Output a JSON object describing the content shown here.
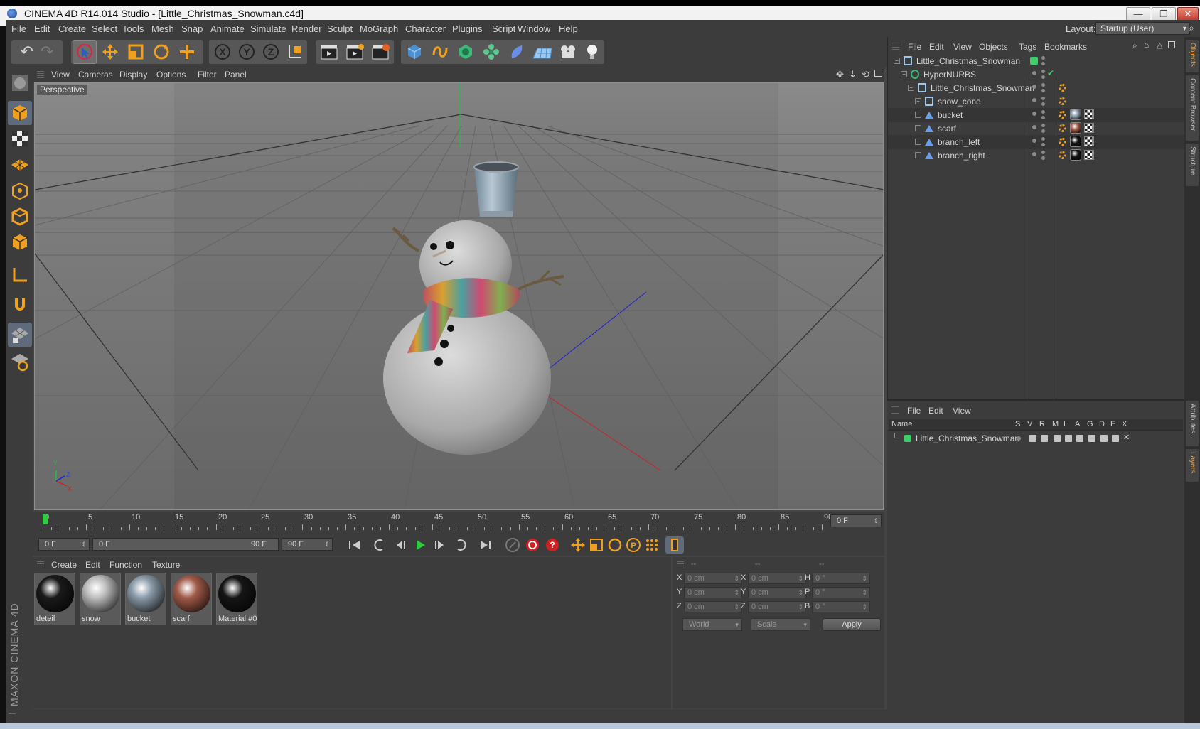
{
  "window": {
    "title": "CINEMA 4D R14.014 Studio - [Little_Christmas_Snowman.c4d]",
    "minimize": "—",
    "maximize": "❐",
    "close": "✕"
  },
  "menubar": {
    "items": [
      "File",
      "Edit",
      "Create",
      "Select",
      "Tools",
      "Mesh",
      "Snap",
      "Animate",
      "Simulate",
      "Render",
      "Sculpt",
      "MoGraph",
      "Character",
      "Plugins",
      "Script",
      "Window",
      "Help"
    ],
    "layout_label": "Layout:",
    "layout_value": "Startup (User)"
  },
  "viewport": {
    "menu": [
      "View",
      "Cameras",
      "Display",
      "Options",
      "Filter",
      "Panel"
    ],
    "label": "Perspective",
    "axis_labels": {
      "y": "Y",
      "x": "X",
      "z": "Z"
    }
  },
  "timeline": {
    "ticks": [
      "0",
      "5",
      "10",
      "15",
      "20",
      "25",
      "30",
      "35",
      "40",
      "45",
      "50",
      "55",
      "60",
      "65",
      "70",
      "75",
      "80",
      "85",
      "90"
    ],
    "current_frame": "0 F",
    "start_frame": "0 F",
    "range_start": "0 F",
    "range_end": "90 F",
    "end_frame": "90 F"
  },
  "materials": {
    "menu": [
      "Create",
      "Edit",
      "Function",
      "Texture"
    ],
    "items": [
      {
        "name": "deteil",
        "color": "#1a1a1a"
      },
      {
        "name": "snow",
        "color": "#bdbdbd"
      },
      {
        "name": "bucket",
        "color": "#8a9aa8"
      },
      {
        "name": "scarf",
        "color": "#a05a48"
      },
      {
        "name": "Material #0",
        "color": "#151515"
      }
    ]
  },
  "coordinates": {
    "header": [
      "--",
      "--",
      "--"
    ],
    "rows": [
      {
        "pos_label": "X",
        "pos": "0 cm",
        "size_label": "X",
        "size": "0 cm",
        "rot_label": "H",
        "rot": "0 °"
      },
      {
        "pos_label": "Y",
        "pos": "0 cm",
        "size_label": "Y",
        "size": "0 cm",
        "rot_label": "P",
        "rot": "0 °"
      },
      {
        "pos_label": "Z",
        "pos": "0 cm",
        "size_label": "Z",
        "size": "0 cm",
        "rot_label": "B",
        "rot": "0 °"
      }
    ],
    "space": "World",
    "mode": "Scale",
    "apply": "Apply"
  },
  "objects": {
    "menu": [
      "File",
      "Edit",
      "View",
      "Objects",
      "Tags",
      "Bookmarks"
    ],
    "tree": [
      {
        "name": "Little_Christmas_Snowman",
        "level": 0,
        "icon": "null-icon"
      },
      {
        "name": "HyperNURBS",
        "level": 1,
        "icon": "hypernurbs-icon"
      },
      {
        "name": "Little_Christmas_Snowman",
        "level": 2,
        "icon": "null-icon"
      },
      {
        "name": "snow_cone",
        "level": 3,
        "icon": "null-icon"
      },
      {
        "name": "bucket",
        "level": 3,
        "icon": "polygon-icon"
      },
      {
        "name": "scarf",
        "level": 3,
        "icon": "polygon-icon"
      },
      {
        "name": "branch_left",
        "level": 3,
        "icon": "polygon-icon"
      },
      {
        "name": "branch_right",
        "level": 3,
        "icon": "polygon-icon"
      }
    ]
  },
  "layers": {
    "menu": [
      "File",
      "Edit",
      "View"
    ],
    "columns": [
      "Name",
      "S",
      "V",
      "R",
      "M",
      "L",
      "A",
      "G",
      "D",
      "E",
      "X"
    ],
    "rows": [
      {
        "name": "Little_Christmas_Snowman"
      }
    ]
  },
  "side_tabs": {
    "top": [
      "Objects",
      "Content Browser",
      "Structure"
    ],
    "bottom": [
      "Attributes",
      "Layers"
    ]
  },
  "brand": {
    "text": "MAXON CINEMA 4D"
  },
  "colors": {
    "accent": "#e8a040",
    "panel": "#3c3c3c",
    "viewport": "#7d7d7d",
    "tool_blue": "#4a8fd0",
    "tool_orange": "#f0a020"
  }
}
